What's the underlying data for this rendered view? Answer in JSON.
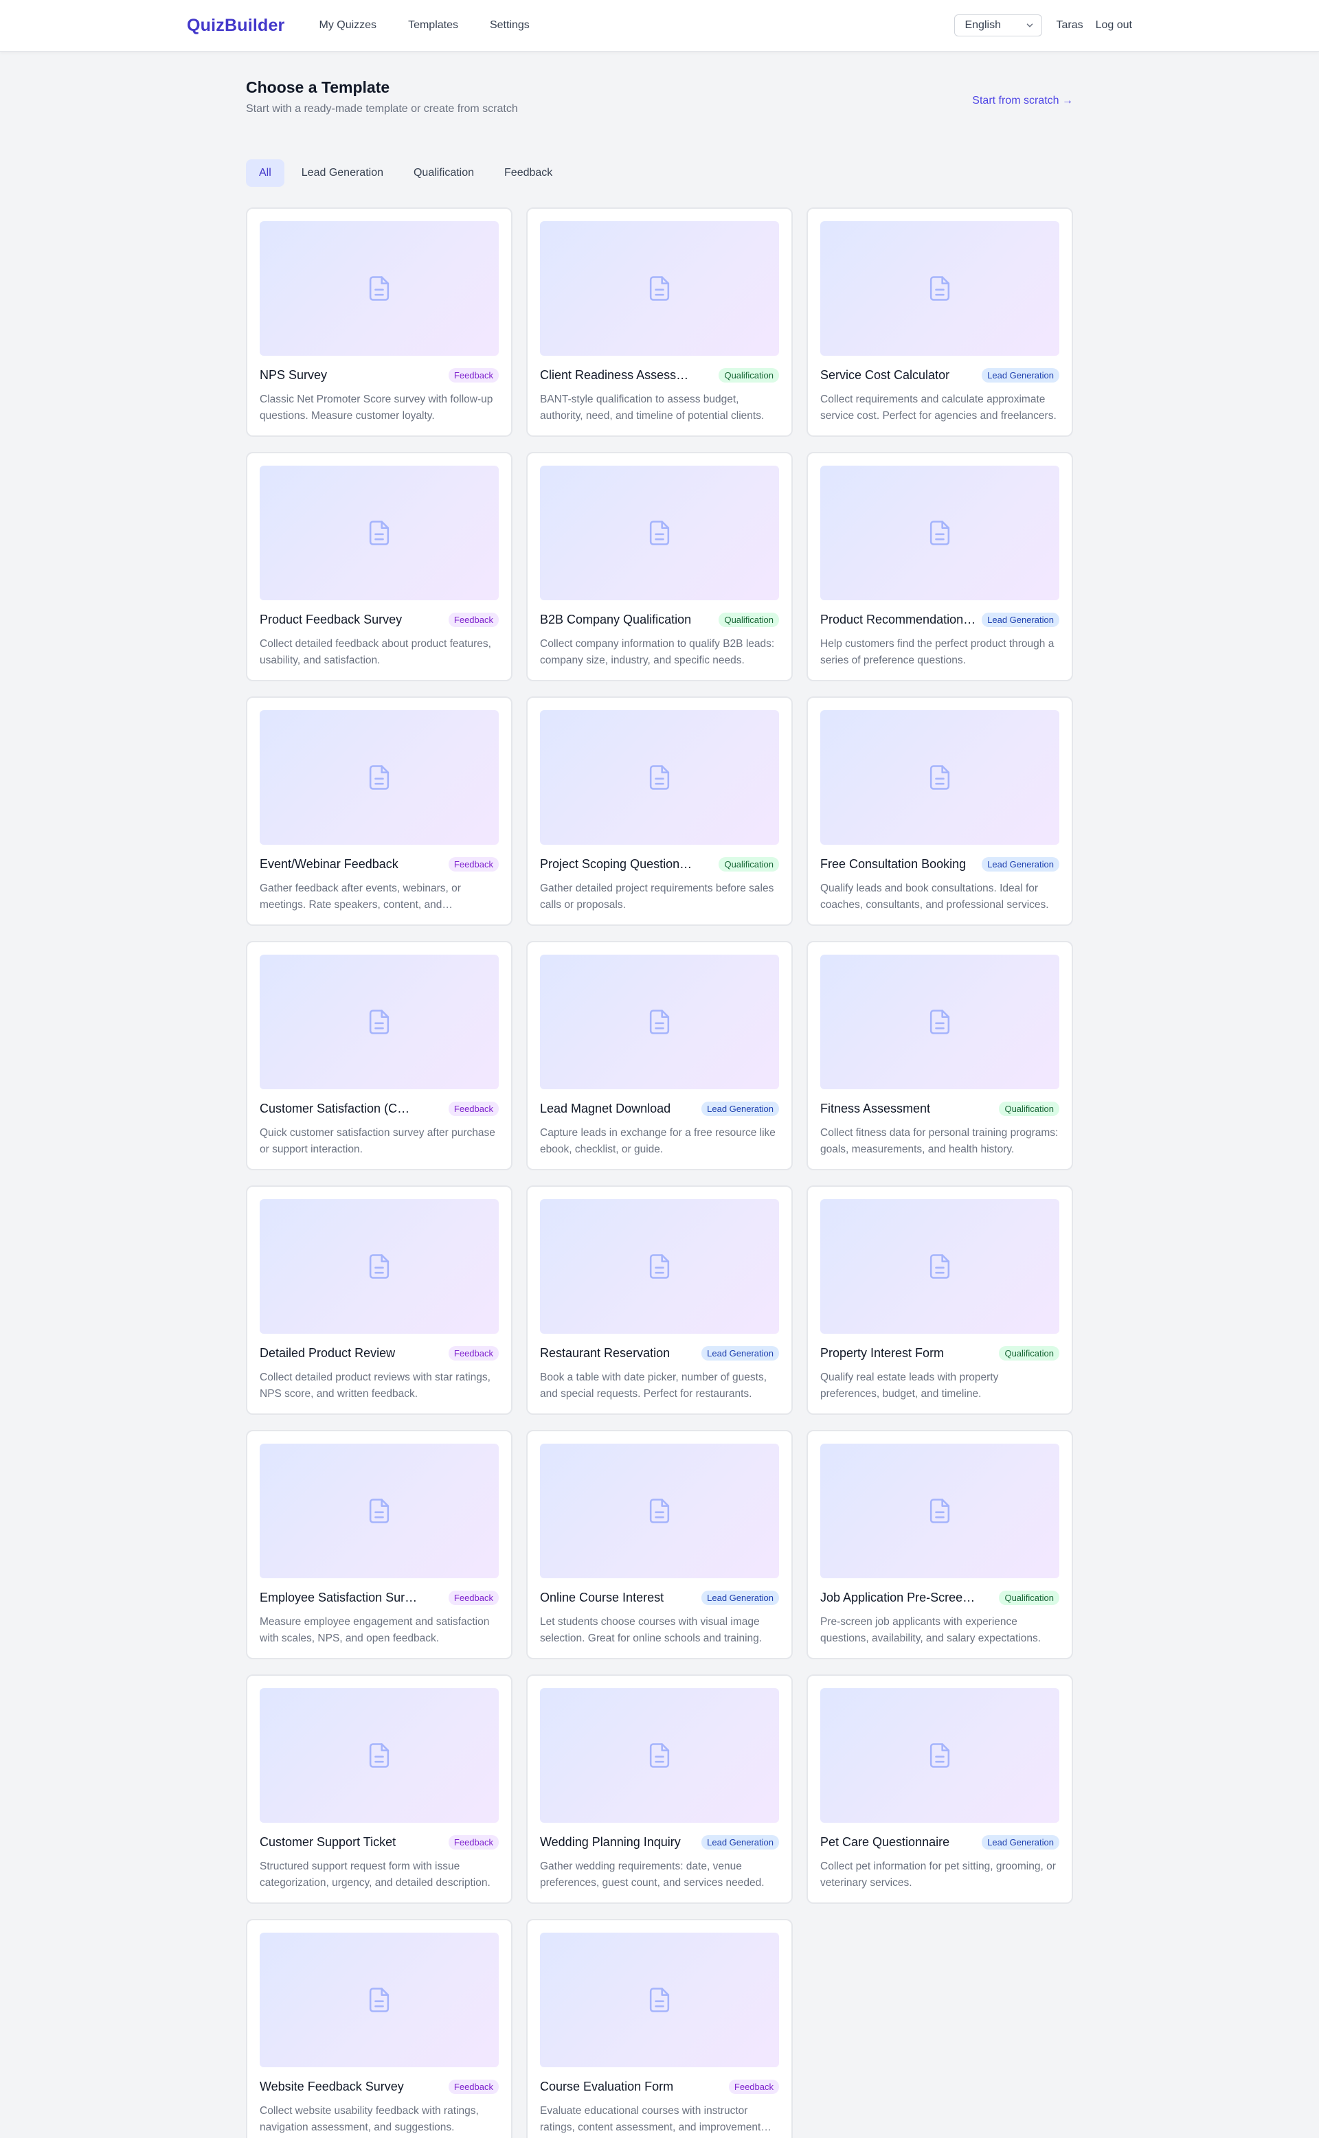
{
  "nav": {
    "logo": "QuizBuilder",
    "links": [
      "My Quizzes",
      "Templates",
      "Settings"
    ],
    "language": "English",
    "user": "Taras",
    "logout": "Log out"
  },
  "header": {
    "title": "Choose a Template",
    "subtitle": "Start with a ready-made template or create from scratch",
    "scratch_link": "Start from scratch →"
  },
  "filters": {
    "tabs": [
      "All",
      "Lead Generation",
      "Qualification",
      "Feedback"
    ],
    "active": "All"
  },
  "colors": {
    "accent": "#4f46e5",
    "feedback_badge": "#f3e8ff",
    "qualification_badge": "#dcfce7",
    "lead_badge": "#dbeafe"
  },
  "templates": [
    {
      "title": "NPS Survey",
      "category": "Feedback",
      "kind": "feedback",
      "description": "Classic Net Promoter Score survey with follow-up questions. Measure customer loyalty."
    },
    {
      "title": "Client Readiness Assessment",
      "category": "Qualification",
      "kind": "qualification",
      "description": "BANT-style qualification to assess budget, authority, need, and timeline of potential clients."
    },
    {
      "title": "Service Cost Calculator",
      "category": "Lead Generation",
      "kind": "lead",
      "description": "Collect requirements and calculate approximate service cost. Perfect for agencies and freelancers."
    },
    {
      "title": "Product Feedback Survey",
      "category": "Feedback",
      "kind": "feedback",
      "description": "Collect detailed feedback about product features, usability, and satisfaction."
    },
    {
      "title": "B2B Company Qualification",
      "category": "Qualification",
      "kind": "qualification",
      "description": "Collect company information to qualify B2B leads: company size, industry, and specific needs."
    },
    {
      "title": "Product Recommendation Quiz",
      "category": "Lead Generation",
      "kind": "lead",
      "description": "Help customers find the perfect product through a series of preference questions."
    },
    {
      "title": "Event/Webinar Feedback",
      "category": "Feedback",
      "kind": "feedback",
      "description": "Gather feedback after events, webinars, or meetings. Rate speakers, content, and organization."
    },
    {
      "title": "Project Scoping Questionnaire",
      "category": "Qualification",
      "kind": "qualification",
      "description": "Gather detailed project requirements before sales calls or proposals."
    },
    {
      "title": "Free Consultation Booking",
      "category": "Lead Generation",
      "kind": "lead",
      "description": "Qualify leads and book consultations. Ideal for coaches, consultants, and professional services."
    },
    {
      "title": "Customer Satisfaction (CSAT)",
      "category": "Feedback",
      "kind": "feedback",
      "description": "Quick customer satisfaction survey after purchase or support interaction."
    },
    {
      "title": "Lead Magnet Download",
      "category": "Lead Generation",
      "kind": "lead",
      "description": "Capture leads in exchange for a free resource like ebook, checklist, or guide."
    },
    {
      "title": "Fitness Assessment",
      "category": "Qualification",
      "kind": "qualification",
      "description": "Collect fitness data for personal training programs: goals, measurements, and health history."
    },
    {
      "title": "Detailed Product Review",
      "category": "Feedback",
      "kind": "feedback",
      "description": "Collect detailed product reviews with star ratings, NPS score, and written feedback."
    },
    {
      "title": "Restaurant Reservation",
      "category": "Lead Generation",
      "kind": "lead",
      "description": "Book a table with date picker, number of guests, and special requests. Perfect for restaurants."
    },
    {
      "title": "Property Interest Form",
      "category": "Qualification",
      "kind": "qualification",
      "description": "Qualify real estate leads with property preferences, budget, and timeline."
    },
    {
      "title": "Employee Satisfaction Survey",
      "category": "Feedback",
      "kind": "feedback",
      "description": "Measure employee engagement and satisfaction with scales, NPS, and open feedback."
    },
    {
      "title": "Online Course Interest",
      "category": "Lead Generation",
      "kind": "lead",
      "description": "Let students choose courses with visual image selection. Great for online schools and training."
    },
    {
      "title": "Job Application Pre-Screening",
      "category": "Qualification",
      "kind": "qualification",
      "description": "Pre-screen job applicants with experience questions, availability, and salary expectations."
    },
    {
      "title": "Customer Support Ticket",
      "category": "Feedback",
      "kind": "feedback",
      "description": "Structured support request form with issue categorization, urgency, and detailed description."
    },
    {
      "title": "Wedding Planning Inquiry",
      "category": "Lead Generation",
      "kind": "lead",
      "description": "Gather wedding requirements: date, venue preferences, guest count, and services needed."
    },
    {
      "title": "Pet Care Questionnaire",
      "category": "Lead Generation",
      "kind": "lead",
      "description": "Collect pet information for pet sitting, grooming, or veterinary services."
    },
    {
      "title": "Website Feedback Survey",
      "category": "Feedback",
      "kind": "feedback",
      "description": "Collect website usability feedback with ratings, navigation assessment, and suggestions."
    },
    {
      "title": "Course Evaluation Form",
      "category": "Feedback",
      "kind": "feedback",
      "description": "Evaluate educational courses with instructor ratings, content assessment, and improvement ideas."
    }
  ]
}
